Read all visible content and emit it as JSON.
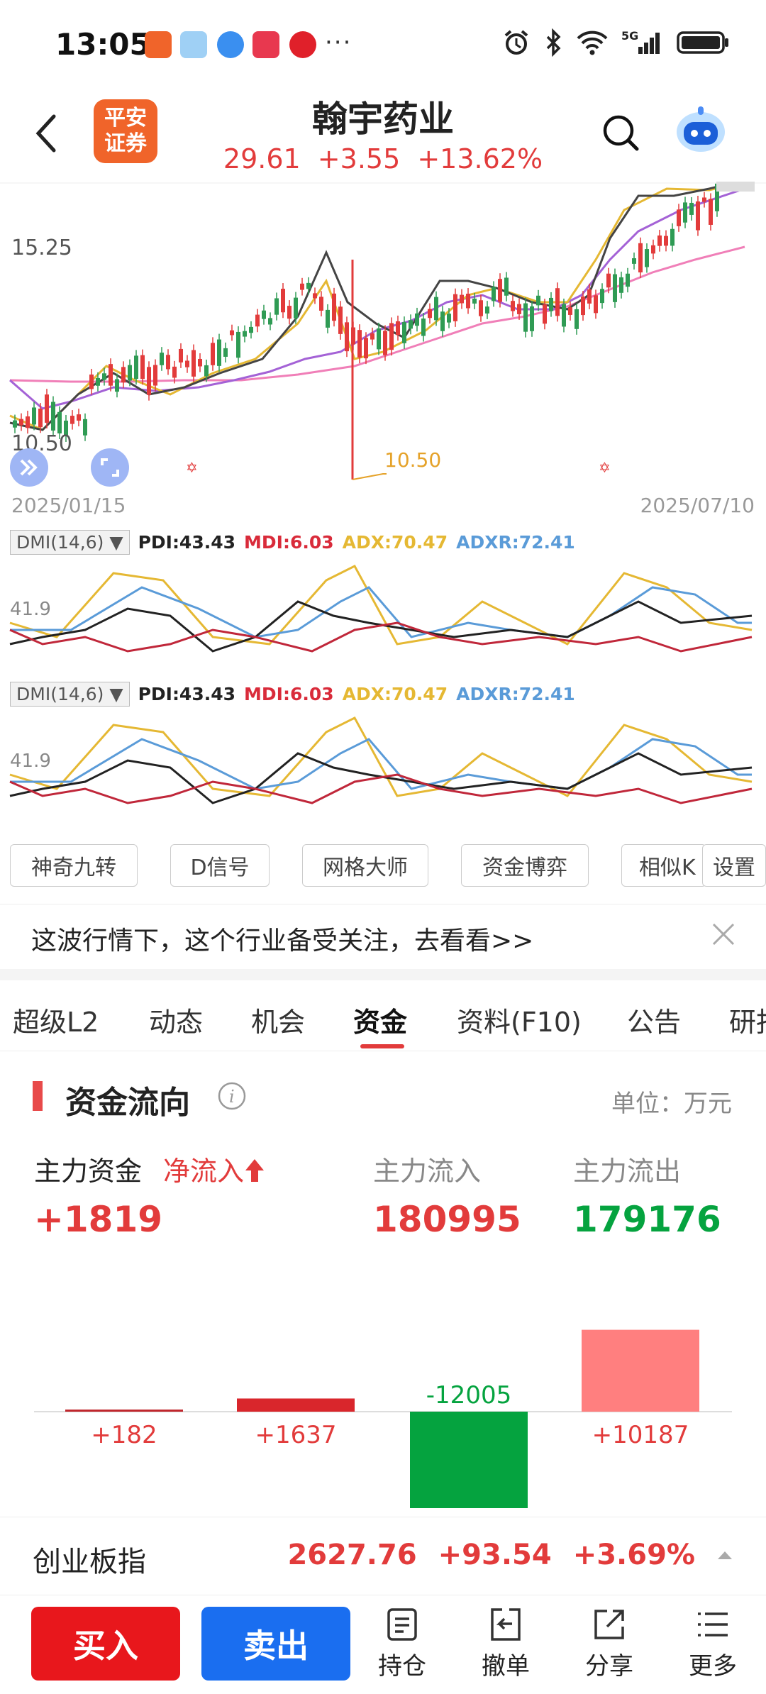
{
  "status": {
    "time": "13:05",
    "dots": "···",
    "network": "5G"
  },
  "header": {
    "logo_line1": "平安",
    "logo_line2": "证券",
    "title": "翰宇药业",
    "price": "29.61",
    "change": "+3.55",
    "change_pct": "+13.62%"
  },
  "kline": {
    "price_high_label": "15.25",
    "price_low_label": "10.50",
    "min_marker": "10.50",
    "date_start": "2025/01/15",
    "date_end": "2025/07/10"
  },
  "indicators": [
    {
      "tag": "DMI(14,6)",
      "pdi": "PDI:43.43",
      "mdi": "MDI:6.03",
      "adx": "ADX:70.47",
      "adxr": "ADXR:72.41",
      "level": "41.9"
    },
    {
      "tag": "DMI(14,6)",
      "pdi": "PDI:43.43",
      "mdi": "MDI:6.03",
      "adx": "ADX:70.47",
      "adxr": "ADXR:72.41",
      "level": "41.9"
    }
  ],
  "tools": [
    "神奇九转",
    "D信号",
    "网格大师",
    "资金博弈",
    "相似K",
    "设置"
  ],
  "banner": {
    "text": "这波行情下，这个行业备受关注，去看看>>"
  },
  "tabs": [
    "超级L2",
    "动态",
    "机会",
    "资金",
    "资料(F10)",
    "公告",
    "研报"
  ],
  "active_tab": "资金",
  "fund": {
    "title": "资金流向",
    "unit": "单位：万元",
    "main_label": "主力资金",
    "net_label": "净流入",
    "inflow_label": "主力流入",
    "outflow_label": "主力流出",
    "net_value": "+1819",
    "inflow_value": "180995",
    "outflow_value": "179176"
  },
  "chart_data": {
    "type": "bar",
    "categories": [
      "",
      "",
      "",
      ""
    ],
    "values": [
      182,
      1637,
      -12005,
      10187
    ],
    "labels": [
      "+182",
      "+1637",
      "-12005",
      "+10187"
    ],
    "colors": [
      "#c0272d",
      "#d9262c",
      "#05a33f",
      "#ff7f7f"
    ]
  },
  "index": {
    "name": "创业板指",
    "value": "2627.76",
    "change": "+93.54",
    "change_pct": "+3.69%"
  },
  "bottom": {
    "buy": "买入",
    "sell": "卖出",
    "nav": [
      "持仓",
      "撤单",
      "分享",
      "更多"
    ]
  },
  "colors": {
    "up": "#e23b3b",
    "down": "#05a33f",
    "buy": "#e8171c",
    "sell": "#1a6ef0",
    "accent": "#e23b3b"
  }
}
